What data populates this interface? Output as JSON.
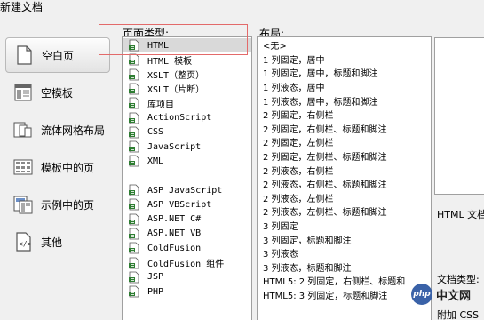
{
  "window": {
    "title": "新建文档"
  },
  "categories": [
    {
      "label": "空白页",
      "icon": "blank-page-icon",
      "selected": true
    },
    {
      "label": "空模板",
      "icon": "blank-template-icon",
      "selected": false
    },
    {
      "label": "流体网格布局",
      "icon": "fluid-grid-icon",
      "selected": false
    },
    {
      "label": "模板中的页",
      "icon": "template-page-icon",
      "selected": false
    },
    {
      "label": "示例中的页",
      "icon": "sample-page-icon",
      "selected": false
    },
    {
      "label": "其他",
      "icon": "code-icon",
      "selected": false
    }
  ],
  "page_type": {
    "header": "页面类型:",
    "items": [
      {
        "label": "HTML",
        "selected": true
      },
      {
        "label": "HTML 模板"
      },
      {
        "label": "XSLT（整页）"
      },
      {
        "label": "XSLT（片断）"
      },
      {
        "label": "库项目"
      },
      {
        "label": "ActionScript"
      },
      {
        "label": "CSS"
      },
      {
        "label": "JavaScript"
      },
      {
        "label": "XML"
      },
      {
        "label": ""
      },
      {
        "label": "ASP JavaScript"
      },
      {
        "label": "ASP VBScript"
      },
      {
        "label": "ASP.NET C#"
      },
      {
        "label": "ASP.NET VB"
      },
      {
        "label": "ColdFusion"
      },
      {
        "label": "ColdFusion 组件"
      },
      {
        "label": "JSP"
      },
      {
        "label": "PHP"
      }
    ]
  },
  "layout": {
    "header": "布局:",
    "items": [
      "<无>",
      "1 列固定，居中",
      "1 列固定，居中，标题和脚注",
      "1 列液态，居中",
      "1 列液态，居中，标题和脚注",
      "2 列固定，右侧栏",
      "2 列固定，右侧栏、标题和脚注",
      "2 列固定，左侧栏",
      "2 列固定，左侧栏、标题和脚注",
      "2 列液态，右侧栏",
      "2 列液态，右侧栏、标题和脚注",
      "2 列液态，左侧栏",
      "2 列液态，左侧栏、标题和脚注",
      "3 列固定",
      "3 列固定，标题和脚注",
      "3 列液态",
      "3 列液态，标题和脚注",
      "HTML5: 2 列固定，右侧栏、标题和",
      "HTML5: 3 列固定，标题和脚注"
    ]
  },
  "preview": {
    "description": "HTML 文档",
    "doc_type_label": "文档类型:",
    "attach_css_label": "附加 CSS"
  },
  "watermark": {
    "logo": "php",
    "text": "中文网"
  },
  "colors": {
    "highlight": "#e36a6a",
    "selected_row": "#d9d9d9",
    "icon_green": "#2e7d32"
  }
}
